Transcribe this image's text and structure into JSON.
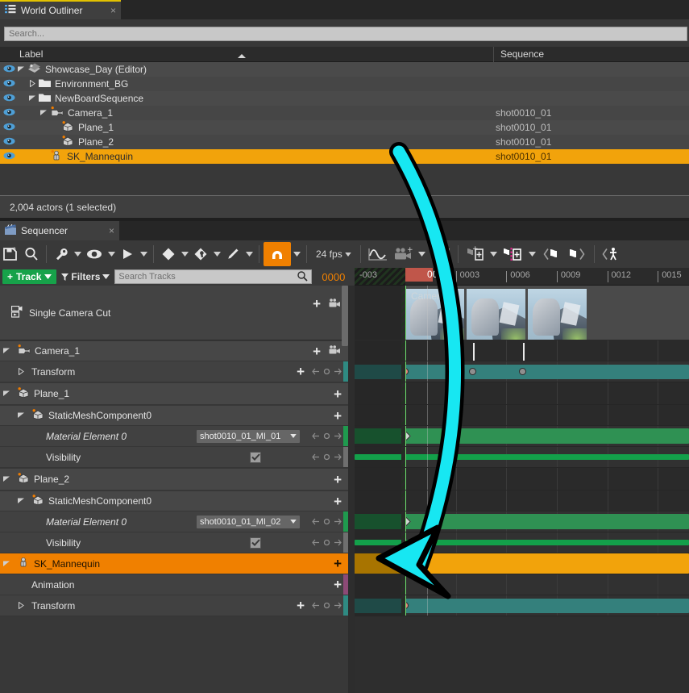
{
  "outliner": {
    "tab_label": "World Outliner",
    "tab_close": "×",
    "search_placeholder": "Search...",
    "columns": {
      "label": "Label",
      "sequence": "Sequence"
    },
    "rows": [
      {
        "label": "Showcase_Day (Editor)",
        "sequence": "",
        "indent": 0,
        "icon": "world-icon",
        "disclosure": "down",
        "selected": false
      },
      {
        "label": "Environment_BG",
        "sequence": "",
        "indent": 1,
        "icon": "folder-icon",
        "disclosure": "right",
        "selected": false
      },
      {
        "label": "NewBoardSequence",
        "sequence": "",
        "indent": 1,
        "icon": "folder-icon",
        "disclosure": "down",
        "selected": false
      },
      {
        "label": "Camera_1",
        "sequence": "shot0010_01",
        "indent": 2,
        "icon": "camera-icon",
        "disclosure": "down",
        "selected": false
      },
      {
        "label": "Plane_1",
        "sequence": "shot0010_01",
        "indent": 3,
        "icon": "mesh-icon",
        "disclosure": "none",
        "selected": false
      },
      {
        "label": "Plane_2",
        "sequence": "shot0010_01",
        "indent": 3,
        "icon": "mesh-icon",
        "disclosure": "none",
        "selected": false
      },
      {
        "label": "SK_Mannequin",
        "sequence": "shot0010_01",
        "indent": 2,
        "icon": "skeletal-icon",
        "disclosure": "none",
        "selected": true
      }
    ],
    "status": "2,004 actors (1 selected)"
  },
  "sequencer": {
    "tab_label": "Sequencer",
    "tab_close": "×",
    "toolbar": {
      "save_label": "save-sequence",
      "find_label": "find",
      "tools_label": "general-options",
      "view_label": "view-options",
      "playback_label": "playback-options",
      "keying_label": "keyframe-options",
      "snapping_label": "snap-options",
      "curve_label": "curve-editor",
      "magnet_active": true,
      "fps_label": "24 fps",
      "accent_orange": "#f08000",
      "accent_green": "#17a24a"
    },
    "filters": {
      "track_button": "Track",
      "filters_button": "Filters",
      "search_placeholder": "Search Tracks",
      "current_frame": "0000"
    },
    "ruler": {
      "start_label": "-003",
      "playhead_label": "0000",
      "ticks": [
        "0003",
        "0006",
        "0009",
        "0012",
        "0015"
      ]
    },
    "camera_cut": {
      "label": "Single Camera Cut",
      "section_label": "Camera_1"
    },
    "tracks": [
      {
        "name": "Camera_1",
        "level": 0,
        "icon": "camera-icon",
        "disclosure": "down",
        "kind": "object",
        "selected": false,
        "color": ""
      },
      {
        "name": "Transform",
        "level": 1,
        "icon": "none",
        "disclosure": "right",
        "kind": "property",
        "selected": false,
        "color": "#2f8a82"
      },
      {
        "name": "Plane_1",
        "level": 0,
        "icon": "mesh-icon",
        "disclosure": "down",
        "kind": "object",
        "selected": false,
        "color": ""
      },
      {
        "name": "StaticMeshComponent0",
        "level": 1,
        "icon": "mesh-icon",
        "disclosure": "down",
        "kind": "object",
        "selected": false,
        "color": ""
      },
      {
        "name": "Material Element 0",
        "level": 2,
        "icon": "none",
        "disclosure": "none",
        "kind": "combo",
        "selected": false,
        "color": "#1f9a4e",
        "value": "shot0010_01_MI_01"
      },
      {
        "name": "Visibility",
        "level": 2,
        "icon": "none",
        "disclosure": "none",
        "kind": "checkbox",
        "selected": false,
        "color": "#6f6f6f",
        "checked": true
      },
      {
        "name": "Plane_2",
        "level": 0,
        "icon": "mesh-icon",
        "disclosure": "down",
        "kind": "object",
        "selected": false,
        "color": ""
      },
      {
        "name": "StaticMeshComponent0",
        "level": 1,
        "icon": "mesh-icon",
        "disclosure": "down",
        "kind": "object",
        "selected": false,
        "color": ""
      },
      {
        "name": "Material Element 0",
        "level": 2,
        "icon": "none",
        "disclosure": "none",
        "kind": "combo",
        "selected": false,
        "color": "#1f9a4e",
        "value": "shot0010_01_MI_02"
      },
      {
        "name": "Visibility",
        "level": 2,
        "icon": "none",
        "disclosure": "none",
        "kind": "checkbox",
        "selected": false,
        "color": "#6f6f6f",
        "checked": true
      },
      {
        "name": "SK_Mannequin",
        "level": 0,
        "icon": "skeletal-icon",
        "disclosure": "down",
        "kind": "object",
        "selected": true,
        "color": "#f08000"
      },
      {
        "name": "Animation",
        "level": 1,
        "icon": "none",
        "disclosure": "none",
        "kind": "track",
        "selected": false,
        "color": "#8c4a76"
      },
      {
        "name": "Transform",
        "level": 1,
        "icon": "none",
        "disclosure": "right",
        "kind": "property",
        "selected": false,
        "color": "#2f8a82"
      }
    ]
  },
  "annotation": {
    "arrow": "cyan-curved-arrow",
    "arrow_color": "#17e7f2"
  }
}
